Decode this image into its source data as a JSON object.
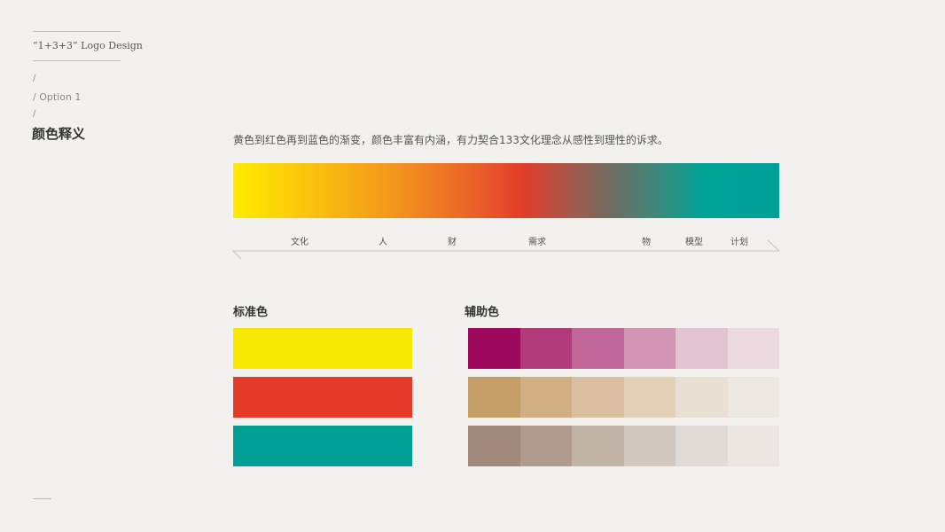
{
  "sidebar": {
    "title": "“1+3+3” Logo Design",
    "slash": "/",
    "option": "/ Option 1",
    "heading": "颜色释义"
  },
  "description": "黄色到红色再到蓝色的渐变，颜色丰富有内涵，有力契合133文化理念从感性到理性的诉求。",
  "gradient": {
    "stops": [
      "#ffec00",
      "#f28d20",
      "#e23c2a",
      "#6a7064",
      "#00a497"
    ],
    "labels": [
      "文化",
      "人",
      "财",
      "需求",
      "物",
      "模型",
      "计划"
    ]
  },
  "standard": {
    "title": "标准色",
    "colors": [
      "#f6e800",
      "#e43a27",
      "#009f95"
    ]
  },
  "auxiliary": {
    "title": "辅助色",
    "rows": [
      [
        "#a00a5e",
        "#b13a7b",
        "#c06698",
        "#d395b6",
        "#e3c4d3",
        "#ecd9df"
      ],
      [
        "#c69e68",
        "#d1ae84",
        "#d9bf9f",
        "#e2d0b8",
        "#e9e0d3",
        "#eee8e2"
      ],
      [
        "#a18a7b",
        "#b09b8e",
        "#c2b3a7",
        "#d2c8bf",
        "#e1dbd7",
        "#ebe6e2"
      ]
    ]
  }
}
